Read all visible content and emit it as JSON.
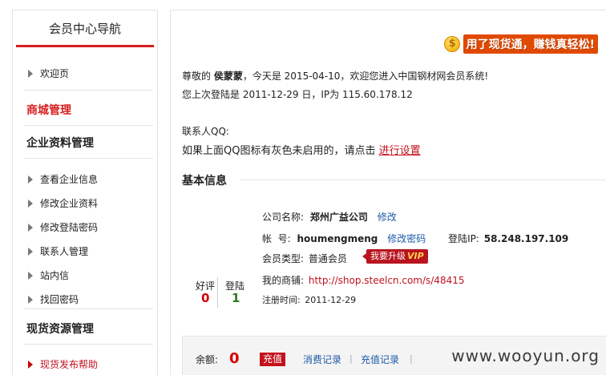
{
  "sidebar": {
    "title": "会员中心导航",
    "welcome": "欢迎页",
    "section_mall": "商城管理",
    "section_company": "企业资料管理",
    "company_items": [
      "查看企业信息",
      "修改企业资料",
      "修改登陆密码",
      "联系人管理",
      "站内信",
      "找回密码"
    ],
    "section_spot": "现货资源管理",
    "spot_items": [
      "现货发布帮助"
    ]
  },
  "promo": {
    "text": "用了现货通，赚钱真轻松!",
    "icon": "coin-bag-icon"
  },
  "greeting": {
    "prefix": "尊敬的",
    "name": "侯蒙蒙",
    "middle": "，今天是 2015-04-10，欢迎您进入中国钢材网会员系统!",
    "last_login": "您上次登陆是 2011-12-29 日，IP为 115.60.178.12"
  },
  "qq": {
    "label": "联系人QQ:",
    "hint": "如果上面QQ图标有灰色未启用的，请点击",
    "link": "进行设置"
  },
  "basic": {
    "title": "基本信息",
    "company_label": "公司名称:",
    "company_value": "郑州广益公司",
    "company_edit": "修改",
    "account_label": "帐  号:",
    "account_value": "houmengmeng",
    "account_edit": "修改密码",
    "login_ip_label": "登陆IP:",
    "login_ip_value": "58.248.197.109",
    "member_type_label": "会员类型:",
    "member_type_value": "普通会员",
    "upgrade_label": "我要升级",
    "upgrade_vip": "VIP",
    "shop_label": "我的商铺:",
    "shop_url": "http://shop.steelcn.com/s/48415",
    "register_label": "注册时间:",
    "register_value": "2011-12-29"
  },
  "ratings": {
    "good_label": "好评",
    "good_value": "0",
    "login_label": "登陆",
    "login_value": "1"
  },
  "balance": {
    "label": "余额:",
    "value": "0",
    "recharge": "充值",
    "consume_records": "消费记录",
    "recharge_records": "充值记录",
    "sep": "|"
  },
  "watermark": "www.wooyun.org",
  "colors": {
    "accent_red": "#d71f1f",
    "link_blue": "#1e5aa8",
    "promo_orange": "#e04a00"
  }
}
